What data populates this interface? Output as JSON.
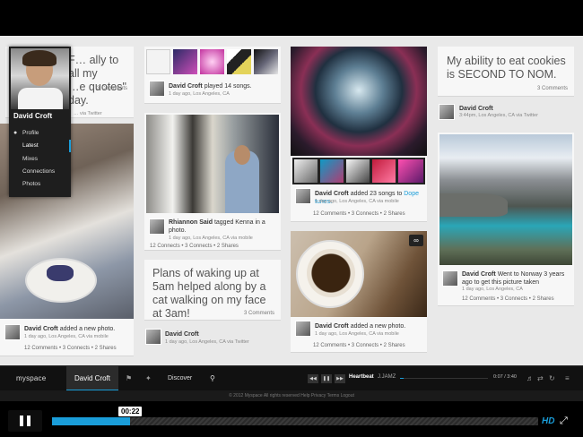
{
  "feed": {
    "col1": {
      "quote": "F… ally to all my\n…e quotes\" day.",
      "quote_comments": "3 Comments",
      "quote_via": "… via Twitter",
      "photo_author": "David Croft",
      "photo_action": "added a new photo.",
      "photo_sub": "1 day ago, Los Angeles, CA via mobile",
      "photo_meta": "12 Comments  •  3 Connects  •  2 Shares"
    },
    "col2": {
      "played_author": "David Croft",
      "played_action": "played 14 songs.",
      "played_sub": "1 day ago, Los Angeles, CA",
      "tag_author": "Rhiannon Said",
      "tag_action": "tagged Kenna in a photo.",
      "tag_sub": "1 day ago, Los Angeles, CA via mobile",
      "tag_meta": "12 Connects  •  3 Connects  •  2 Shares",
      "quote": "Plans of waking up at 5am helped along by a cat walking on my face at 3am!",
      "quote_comments": "3 Comments",
      "quote_author": "David Croft",
      "quote_sub": "1 day ago, Los Angeles, CA via Twitter"
    },
    "col3": {
      "songs_author": "David Croft",
      "songs_action": "added 23 songs to",
      "songs_link": "Dope tunes.",
      "songs_sub": "1 day ago, Los Angeles, CA via mobile",
      "songs_meta": "12 Comments  •  3 Connects  •  2 Shares",
      "coffee_author": "David Croft",
      "coffee_action": "added a new photo.",
      "coffee_sub": "1 day ago, Los Angeles, CA via mobile",
      "coffee_meta": "12 Comments  •  3 Connects  •  2 Shares"
    },
    "col4": {
      "quote": "My ability to eat cookies is SECOND TO NOM.",
      "quote_comments": "3 Comments",
      "quote_author": "David Croft",
      "quote_sub": "3:44pm, Los Angeles, CA via Twitter",
      "norway_author": "David Croft",
      "norway_action": "Went to Norway 3 years ago to get this picture taken",
      "norway_sub": "1 day ago, Los Angeles, CA",
      "norway_meta": "12 Comments  •  3 Connects  •  2 Shares"
    }
  },
  "profile_menu": {
    "name": "David Croft",
    "items": [
      "Profile",
      "Latest",
      "Mixes",
      "Connections",
      "Photos"
    ]
  },
  "myspace_bar": {
    "logo": "myspace",
    "user": "David Croft",
    "discover": "Discover",
    "song": "Heartbeat",
    "artist": "J.JAMZ",
    "time": "0:07 / 3:40"
  },
  "footer": {
    "text": "© 2012 Myspace   All rights reserved   Help   Privacy   Terms   Logout"
  },
  "video": {
    "current_time": "00:22",
    "progress": 0.16,
    "hd_label": "HD"
  },
  "colors": {
    "accent": "#1a9dd9"
  }
}
